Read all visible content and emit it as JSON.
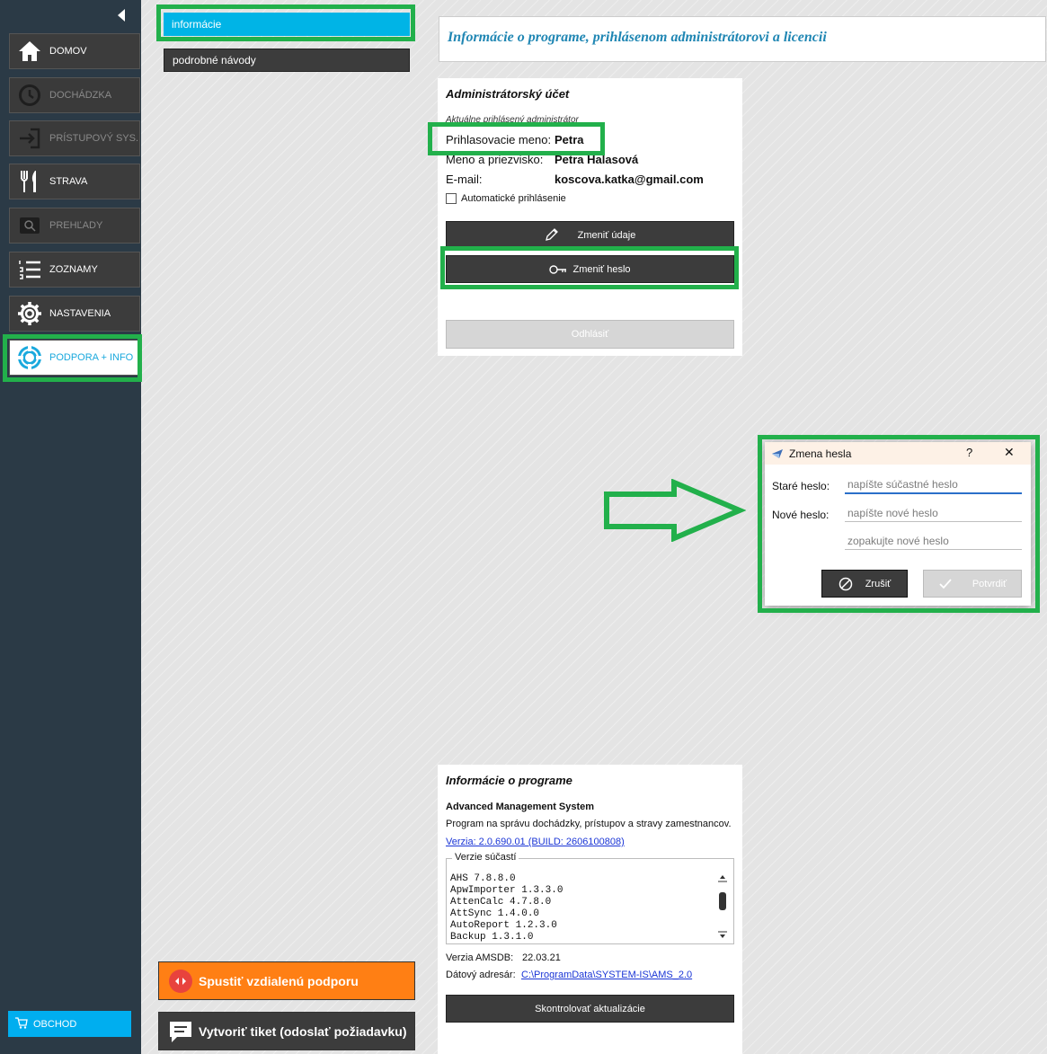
{
  "colors": {
    "sidebar_bg": "#2b3a46",
    "accent": "#00b4e6",
    "highlight": "#22b04b",
    "orange": "#ff7f14",
    "button_dark": "#3c3c3c",
    "title_blue": "#1f86b3"
  },
  "sidebar": {
    "collapse_icon": "triangle-left-icon",
    "items": [
      {
        "label": "DOMOV",
        "icon": "home-icon"
      },
      {
        "label": "DOCHÁDZKA",
        "icon": "clock-icon"
      },
      {
        "label": "PRÍSTUPOVÝ SYS.",
        "icon": "login-icon"
      },
      {
        "label": "STRAVA",
        "icon": "cutlery-icon"
      },
      {
        "label": "PREHĽADY",
        "icon": "search-icon"
      },
      {
        "label": "ZOZNAMY",
        "icon": "list-icon"
      },
      {
        "label": "NASTAVENIA",
        "icon": "gear-icon"
      },
      {
        "label": "PODPORA + INFO",
        "icon": "lifebuoy-icon"
      }
    ],
    "shop_label": "OBCHOD",
    "shop_icon": "cart-icon"
  },
  "left_panel": {
    "tabs": [
      {
        "label": "informácie"
      },
      {
        "label": "podrobné návody"
      }
    ],
    "remote_support_label": "Spustiť vzdialenú podporu",
    "ticket_label": "Vytvoriť tiket (odoslať požiadavku)"
  },
  "header": {
    "title": "Informácie o programe, prihlásenom administrátorovi a licencii"
  },
  "admin": {
    "title": "Administrátorský účet",
    "subtitle": "Aktuálne prihlásený administrátor",
    "login_label": "Prihlasovacie meno:",
    "login_value": "Petra",
    "name_label": "Meno a priezvisko:",
    "name_value": "Petra Halasová",
    "email_label": "E-mail:",
    "email_value": "koscova.katka@gmail.com",
    "auto_login_label": "Automatické prihlásenie",
    "change_details_label": "Zmeniť údaje",
    "change_password_label": "Zmeniť heslo",
    "logout_label": "Odhlásiť"
  },
  "program": {
    "title": "Informácie o programe",
    "name": "Advanced Management System",
    "description": "Program na správu dochádzky, prístupov a stravy zamestnancov.",
    "version_link": "Verzia: 2.0.690.01 (BUILD: 2606100808)",
    "components_legend": "Verzie súčastí",
    "components": [
      "AHS 7.8.8.0",
      "ApwImporter 1.3.3.0",
      "AttenCalc 4.7.8.0",
      "AttSync 1.4.0.0",
      "AutoReport 1.2.3.0",
      "Backup 1.3.1.0"
    ],
    "amsdb_label": "Verzia AMSDB:",
    "amsdb_value": "22.03.21",
    "data_dir_label": "Dátový adresár:",
    "data_dir_value": "C:\\ProgramData\\SYSTEM-IS\\AMS_2.0",
    "check_updates_label": "Skontrolovať aktualizácie"
  },
  "dialog": {
    "title": "Zmena hesla",
    "help": "?",
    "close": "✕",
    "old_label": "Staré heslo:",
    "old_placeholder": "napíšte súčastné heslo",
    "new_label": "Nové heslo:",
    "new_placeholder": "napíšte nové heslo",
    "repeat_placeholder": "zopakujte nové heslo",
    "cancel_label": "Zrušiť",
    "confirm_label": "Potvrdiť"
  }
}
